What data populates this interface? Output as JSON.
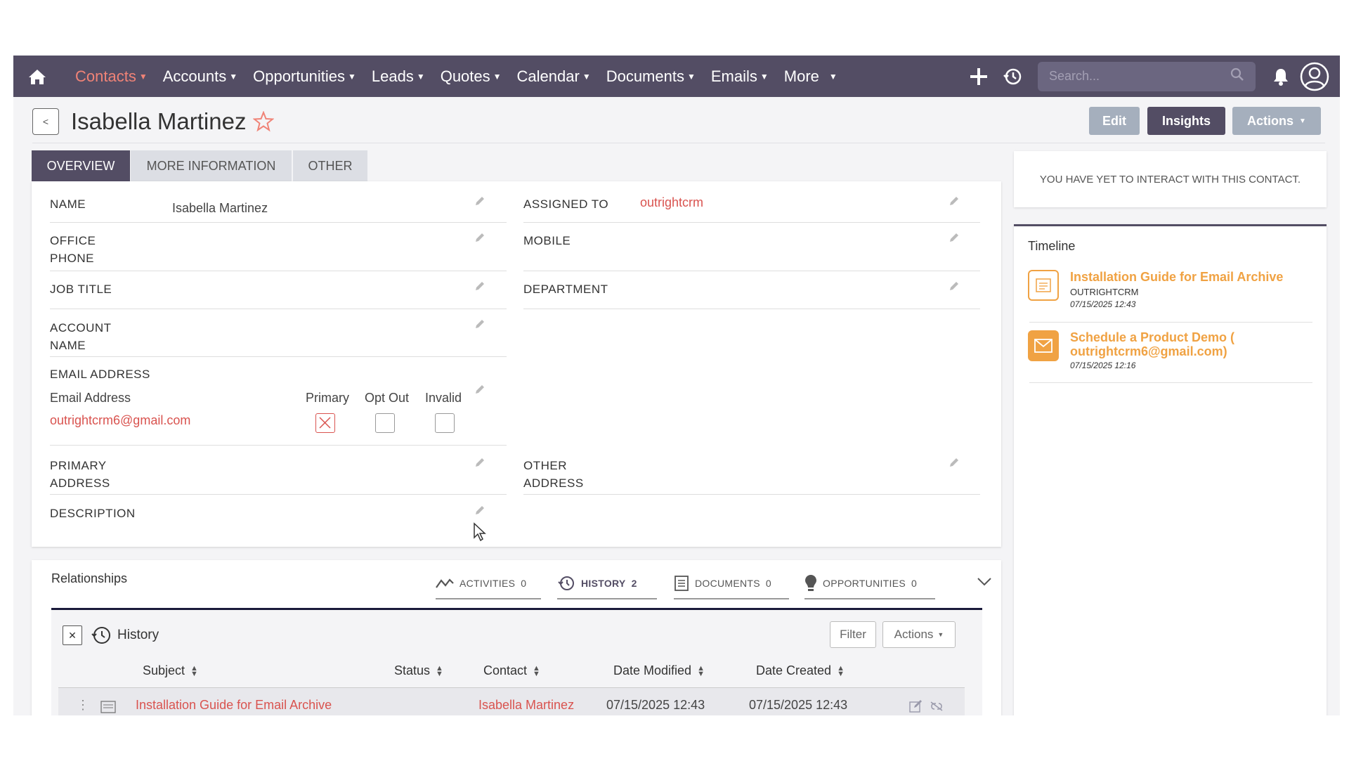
{
  "nav": {
    "items": [
      {
        "label": "Contacts",
        "active": true
      },
      {
        "label": "Accounts",
        "active": false
      },
      {
        "label": "Opportunities",
        "active": false
      },
      {
        "label": "Leads",
        "active": false
      },
      {
        "label": "Quotes",
        "active": false
      },
      {
        "label": "Calendar",
        "active": false
      },
      {
        "label": "Documents",
        "active": false
      },
      {
        "label": "Emails",
        "active": false
      },
      {
        "label": "More",
        "active": false
      }
    ],
    "search_placeholder": "Search...",
    "icons": [
      "home-icon",
      "plus-icon",
      "history-icon",
      "search-icon",
      "bell-icon",
      "user-icon"
    ]
  },
  "record": {
    "title": "Isabella Martinez",
    "buttons": {
      "edit": "Edit",
      "insights": "Insights",
      "actions": "Actions"
    }
  },
  "tabs": [
    "OVERVIEW",
    "MORE INFORMATION",
    "OTHER"
  ],
  "fields": {
    "name_label": "NAME",
    "name_value": "Isabella Martinez",
    "assigned_label": "ASSIGNED TO",
    "assigned_value": "outrightcrm",
    "office_phone_label_1": "OFFICE",
    "office_phone_label_2": "PHONE",
    "mobile_label": "MOBILE",
    "job_title_label": "JOB TITLE",
    "department_label": "DEPARTMENT",
    "account_name_label_1": "ACCOUNT",
    "account_name_label_2": "NAME",
    "email_address_label": "EMAIL ADDRESS",
    "email_sub_label": "Email Address",
    "email_value": "outrightcrm6@gmail.com",
    "primary_label": "Primary",
    "opt_out_label": "Opt Out",
    "invalid_label": "Invalid",
    "primary_address_label_1": "PRIMARY",
    "primary_address_label_2": "ADDRESS",
    "other_address_label_1": "OTHER",
    "other_address_label_2": "ADDRESS",
    "description_label": "DESCRIPTION"
  },
  "sidebar": {
    "interact_text": "YOU HAVE YET TO INTERACT WITH THIS CONTACT.",
    "timeline_title": "Timeline",
    "timeline": [
      {
        "title": "Installation Guide for Email Archive",
        "sub": "OUTRIGHTCRM",
        "date": "07/15/2025 12:43",
        "icon": "document-icon"
      },
      {
        "title": "Schedule a Product Demo ( outrightcrm6@gmail.com)",
        "sub": "",
        "date": "07/15/2025 12:16",
        "icon": "envelope-icon"
      }
    ]
  },
  "relationships": {
    "title": "Relationships",
    "tabs": [
      {
        "label": "ACTIVITIES",
        "count": "0"
      },
      {
        "label": "HISTORY",
        "count": "2"
      },
      {
        "label": "DOCUMENTS",
        "count": "0"
      },
      {
        "label": "OPPORTUNITIES",
        "count": "0"
      }
    ],
    "history": {
      "title": "History",
      "filter": "Filter",
      "actions": "Actions",
      "columns": [
        "Subject",
        "Status",
        "Contact",
        "Date Modified",
        "Date Created"
      ],
      "rows": [
        {
          "subject": "Installation Guide for Email Archive",
          "status": "",
          "contact": "Isabella Martinez",
          "date_modified": "07/15/2025 12:43",
          "date_created": "07/15/2025 12:43"
        }
      ]
    }
  },
  "colors": {
    "nav_bg": "#534d64",
    "active_nav": "#f08377",
    "link": "#d9534f",
    "timeline_accent": "#f0a243"
  }
}
